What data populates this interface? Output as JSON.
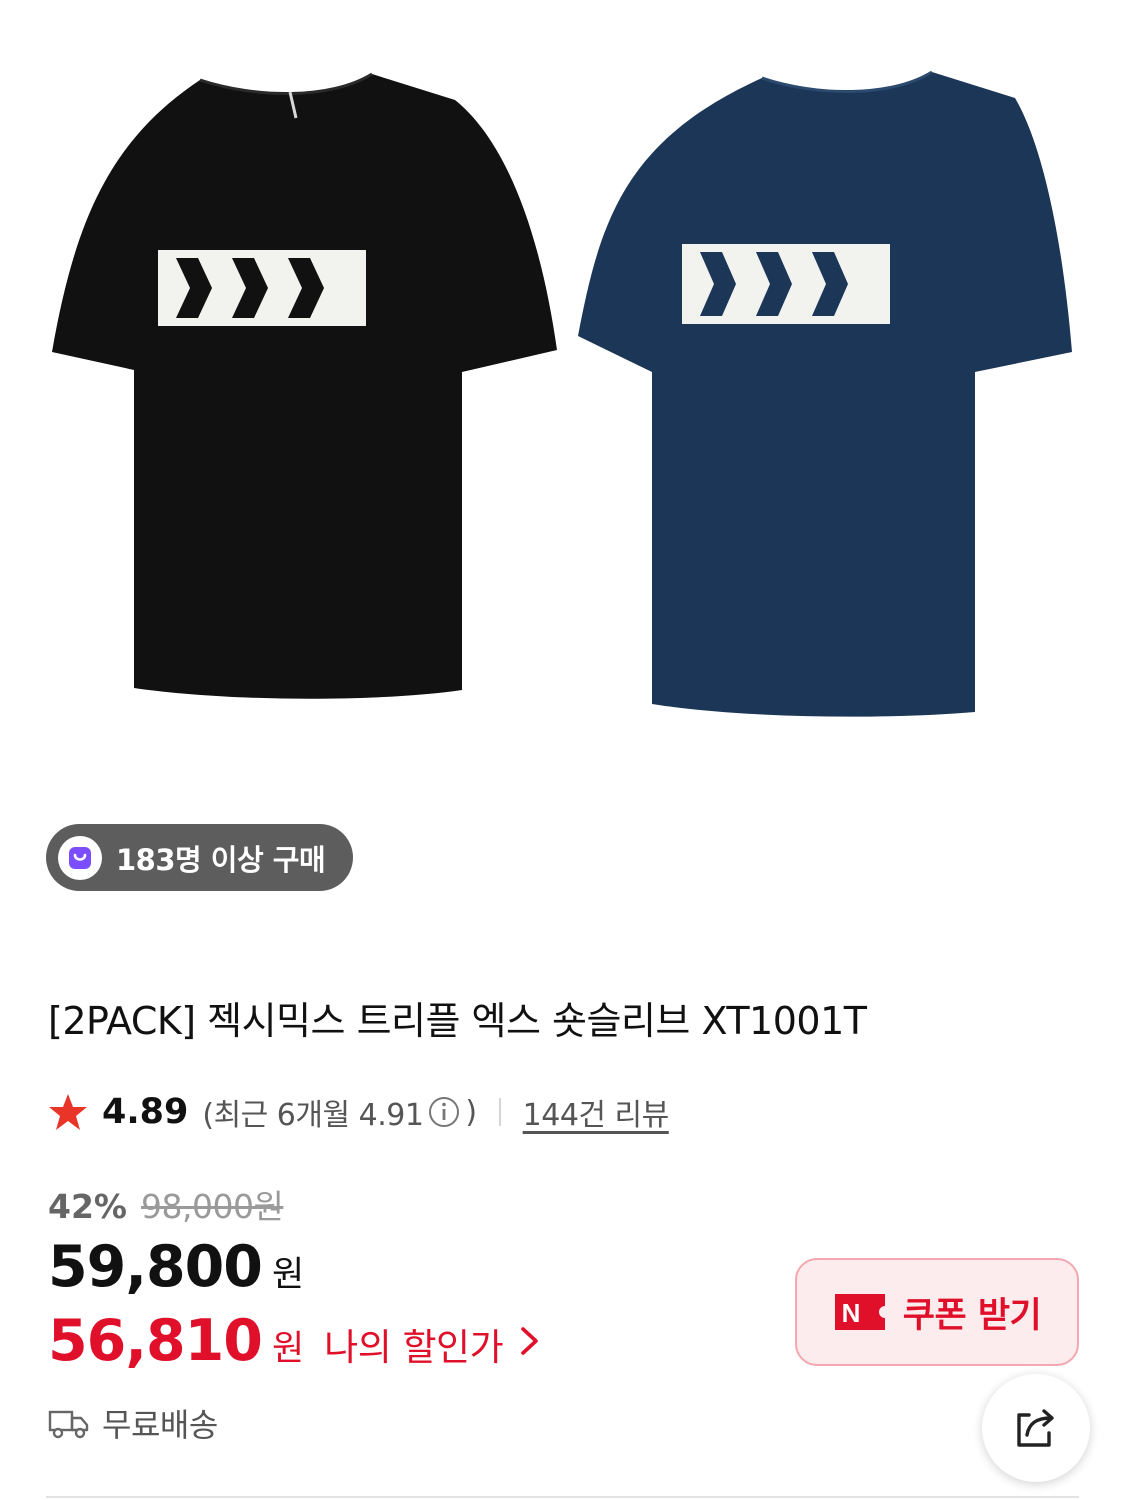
{
  "hero": {
    "shirt_left_color": "#111111",
    "shirt_right_color": "#1b3656",
    "print_color": "#f2f2ee"
  },
  "purchase_badge": {
    "text": "183명 이상 구매",
    "icon": "shopping-bag-icon"
  },
  "product": {
    "title": "[2PACK] 젝시믹스 트리플 엑스 숏슬리브 XT1001T"
  },
  "rating": {
    "score": "4.89",
    "recent_prefix": "(최근 6개월 4.91",
    "recent_suffix": ")",
    "review_count": "144건 리뷰",
    "star_color": "#e93528"
  },
  "price": {
    "discount_rate": "42%",
    "original": "98,000원",
    "sale": "59,800",
    "currency": "원",
    "my_price": "56,810",
    "my_currency": "원",
    "my_label": "나의 할인가",
    "accent": "#e0102a"
  },
  "coupon": {
    "label": "쿠폰 받기",
    "icon": "coupon-n-icon"
  },
  "shipping": {
    "label": "무료배송",
    "icon": "truck-icon"
  },
  "share": {
    "icon": "share-icon"
  }
}
